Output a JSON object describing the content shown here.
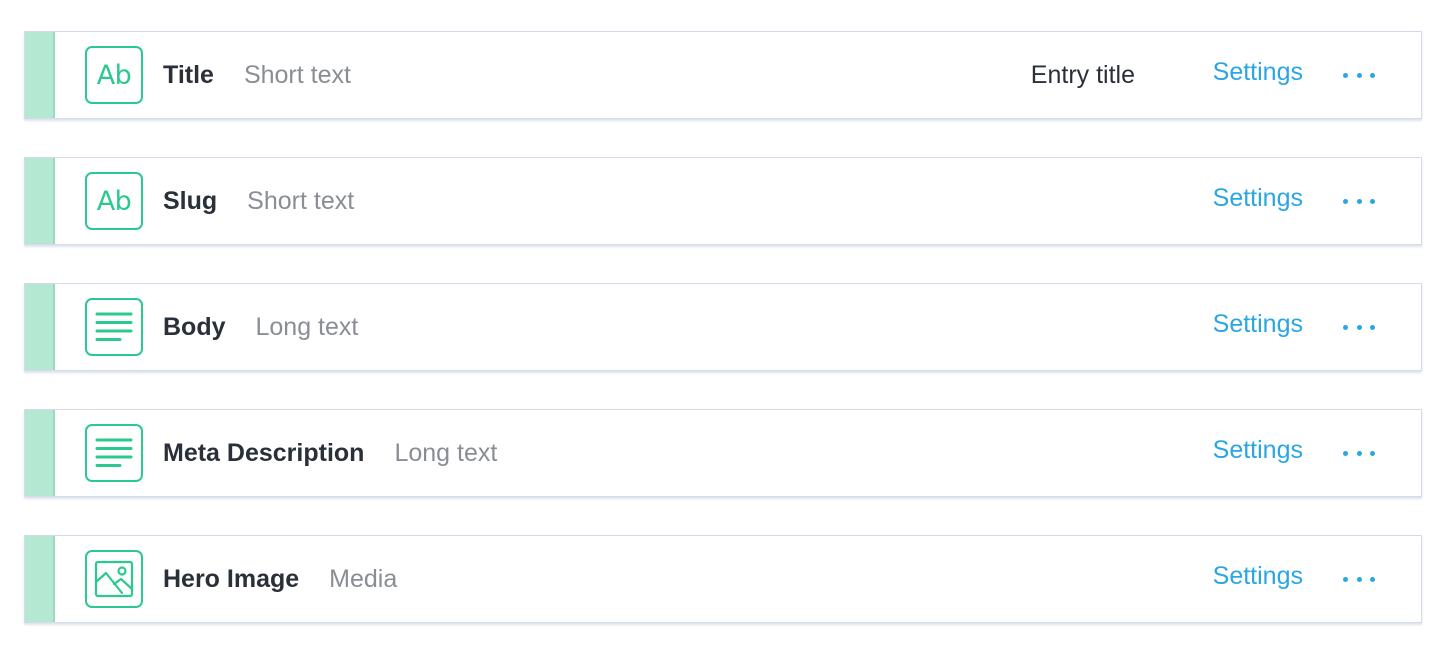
{
  "fields": [
    {
      "name": "Title",
      "type": "Short text",
      "icon": "short-text-icon",
      "icon_text": "Ab",
      "badge": "Entry title",
      "settings_label": "Settings",
      "menu_icon": "more-options-icon"
    },
    {
      "name": "Slug",
      "type": "Short text",
      "icon": "short-text-icon",
      "icon_text": "Ab",
      "settings_label": "Settings",
      "menu_icon": "more-options-icon"
    },
    {
      "name": "Body",
      "type": "Long text",
      "icon": "long-text-icon",
      "settings_label": "Settings",
      "menu_icon": "more-options-icon"
    },
    {
      "name": "Meta Description",
      "type": "Long text",
      "icon": "long-text-icon",
      "settings_label": "Settings",
      "menu_icon": "more-options-icon"
    },
    {
      "name": "Hero Image",
      "type": "Media",
      "icon": "media-icon",
      "settings_label": "Settings",
      "menu_icon": "more-options-icon"
    }
  ],
  "colors": {
    "accent_green": "#2cc98e",
    "handle_green": "#b5e8d2",
    "link_blue": "#2aa6e3",
    "text_dark": "#2a3039",
    "text_muted": "#8a8e94",
    "row_border": "#d3dce8"
  }
}
